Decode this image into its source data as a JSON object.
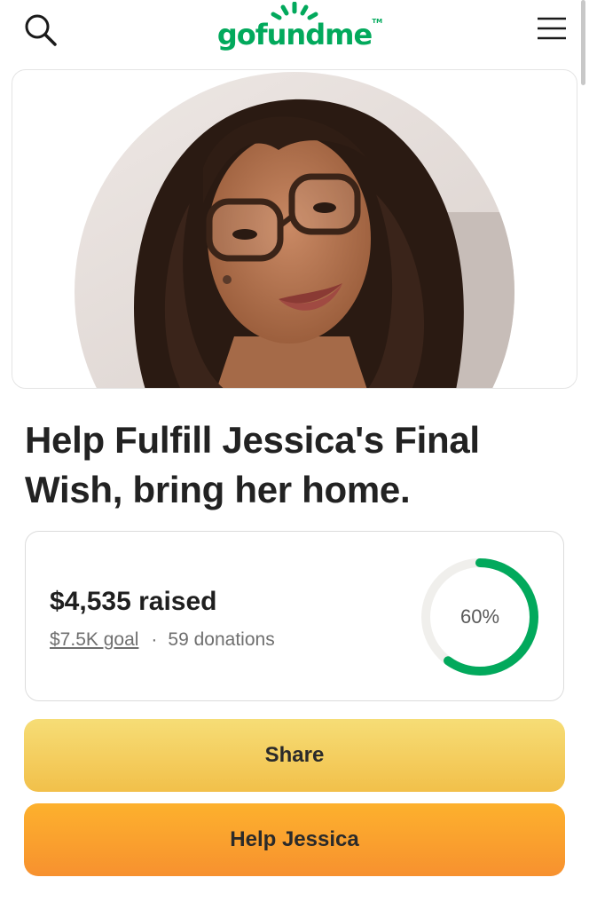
{
  "header": {
    "logo_text": "gofundme",
    "logo_tm": "TM",
    "brand_color": "#02a95c",
    "search_icon": "search-icon",
    "menu_icon": "hamburger-menu-icon"
  },
  "campaign": {
    "title": "Help Fulfill Jessica's Final Wish, bring her home.",
    "photo": "circular portrait photo of a smiling woman with long curly dark hair and glasses"
  },
  "progress": {
    "raised_text": "$4,535 raised",
    "goal_text": "$7.5K goal",
    "separator": "·",
    "donations_text": "59 donations",
    "percent_label": "60%",
    "percent_value": 0.6,
    "ring_color": "#02a95c",
    "ring_track_color": "#f0efec"
  },
  "actions": {
    "share_label": "Share",
    "help_label": "Help Jessica"
  }
}
